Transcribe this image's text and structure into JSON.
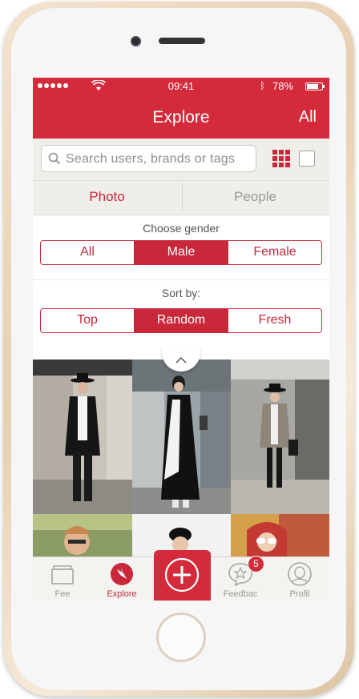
{
  "status_bar": {
    "time": "09:41",
    "battery_percent": "78%",
    "battery_level": 0.78,
    "bluetooth_icon": "bluetooth-icon"
  },
  "nav": {
    "title": "Explore",
    "right_action": "All"
  },
  "search": {
    "placeholder": "Search users, brands or tags",
    "icon": "search-icon"
  },
  "view_toggles": [
    "grid-view-icon",
    "single-view-icon"
  ],
  "tabs": [
    {
      "label": "Photo",
      "active": true
    },
    {
      "label": "People",
      "active": false
    }
  ],
  "gender": {
    "label": "Choose gender",
    "options": [
      "All",
      "Male",
      "Female"
    ],
    "selected": "Male"
  },
  "sort": {
    "label": "Sort by:",
    "options": [
      "Top",
      "Random",
      "Fresh"
    ],
    "selected": "Random"
  },
  "tabbar": {
    "items": [
      {
        "label": "Fee",
        "icon": "feed-icon"
      },
      {
        "label": "Explore",
        "icon": "compass-icon",
        "active": true
      },
      {
        "label": "",
        "icon": "add-icon"
      },
      {
        "label": "Feedbac",
        "icon": "star-bubble-icon",
        "badge": "5"
      },
      {
        "label": "Profil",
        "icon": "profile-icon"
      }
    ]
  },
  "colors": {
    "brand": "#d32b3b",
    "accent": "#c8283a"
  }
}
